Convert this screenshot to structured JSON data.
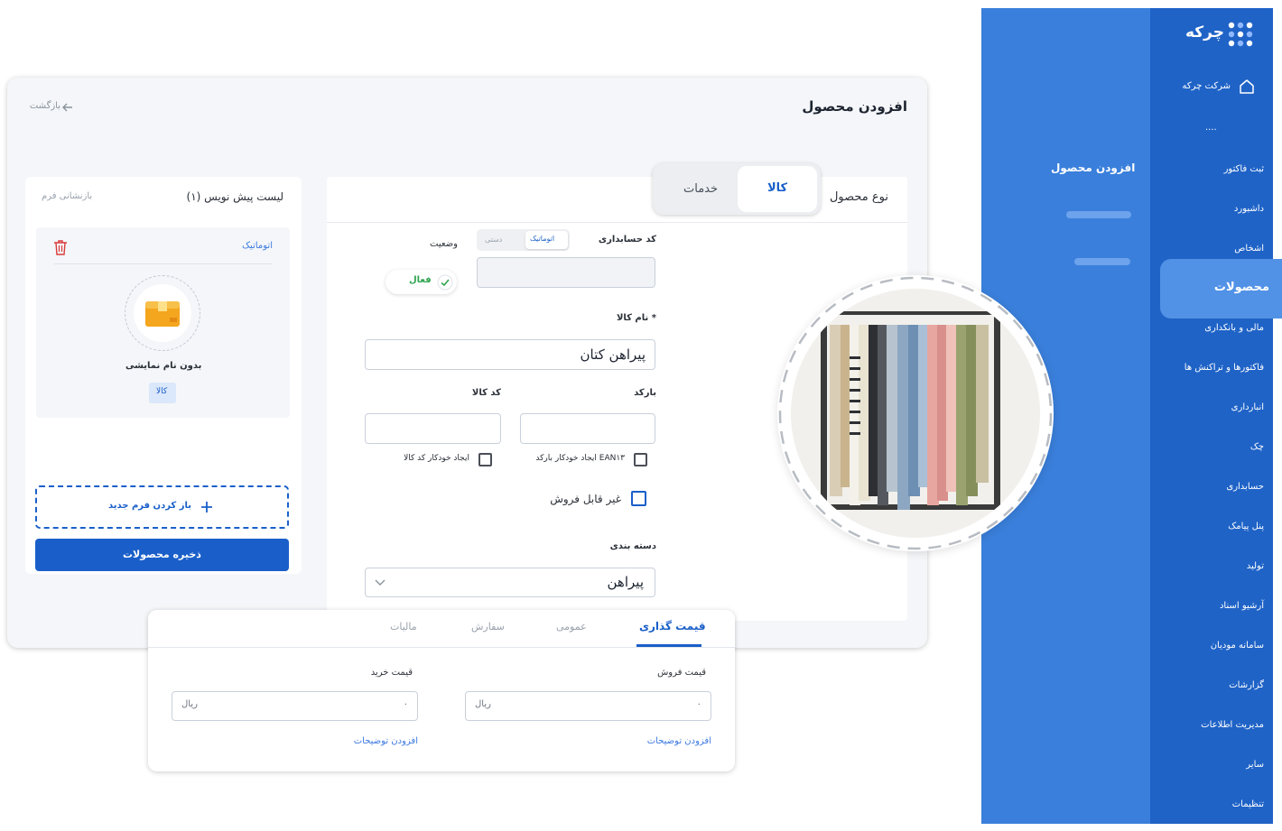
{
  "sidebar": {
    "brand": "چرکه",
    "company": "شرکت چرکه",
    "dots": "....",
    "items": [
      {
        "label": "ثبت فاکتور"
      },
      {
        "label": "داشبورد"
      },
      {
        "label": "اشخاص"
      },
      {
        "label": "محصولات"
      },
      {
        "label": "مالی و بانکداری"
      },
      {
        "label": "فاکتورها و تراکنش ها"
      },
      {
        "label": "انبارداری"
      },
      {
        "label": "چک"
      },
      {
        "label": "حسابداری"
      },
      {
        "label": "پنل پیامک"
      },
      {
        "label": "تولید"
      },
      {
        "label": "آرشیو اسناد"
      },
      {
        "label": "سامانه مودیان"
      },
      {
        "label": "گزارشات"
      },
      {
        "label": "مدیریت اطلاعات"
      },
      {
        "label": "سایر"
      },
      {
        "label": "تنظیمات"
      }
    ],
    "sub_title": "افزودن محصول"
  },
  "page": {
    "title": "افزودن محصول",
    "back": "بازگشت"
  },
  "form": {
    "product_type_label": "نوع محصول",
    "type_goods": "کالا",
    "type_services": "خدمات",
    "accounting_code_label": "کد حسابداری",
    "mode_auto": "اتوماتیک",
    "mode_manual": "دستی",
    "status_label": "وضعیت",
    "status_active": "فعال",
    "name_label": "نام کالا *",
    "name_value": "پیراهن کتان",
    "barcode_label": "بارکد",
    "code_label": "کد کالا",
    "auto_ean_label": "ایجاد خودکار بارکد EAN۱۳",
    "auto_code_label": "ایجاد خودکار کد کالا",
    "not_sellable_label": "غیر قابل فروش",
    "category_label": "دسته بندی",
    "category_value": "پیراهن"
  },
  "drafts": {
    "title": "لیست پیش نویس (۱)",
    "reset": "بازنشانی فرم",
    "item_mode": "اتوماتیک",
    "item_name": "بدون نام نمایشی",
    "item_tag": "کالا",
    "open_new": "باز کردن فرم جدید",
    "save": "ذخیره محصولات"
  },
  "tabs": {
    "items": [
      "قیمت گذاری",
      "عمومی",
      "سفارش",
      "مالیات"
    ],
    "active": "قیمت گذاری",
    "sell_label": "قیمت فروش",
    "buy_label": "قیمت خرید",
    "sell_value": "۰",
    "buy_value": "۰",
    "currency": "ریال",
    "add_desc": "افزودن توضیحات"
  },
  "colors": {
    "sidebar_main": "#1f63c7",
    "sidebar_secondary": "#3a7fdb",
    "primary": "#1a5fc9",
    "active_green": "#2fa44f",
    "danger": "#d93b3b"
  }
}
